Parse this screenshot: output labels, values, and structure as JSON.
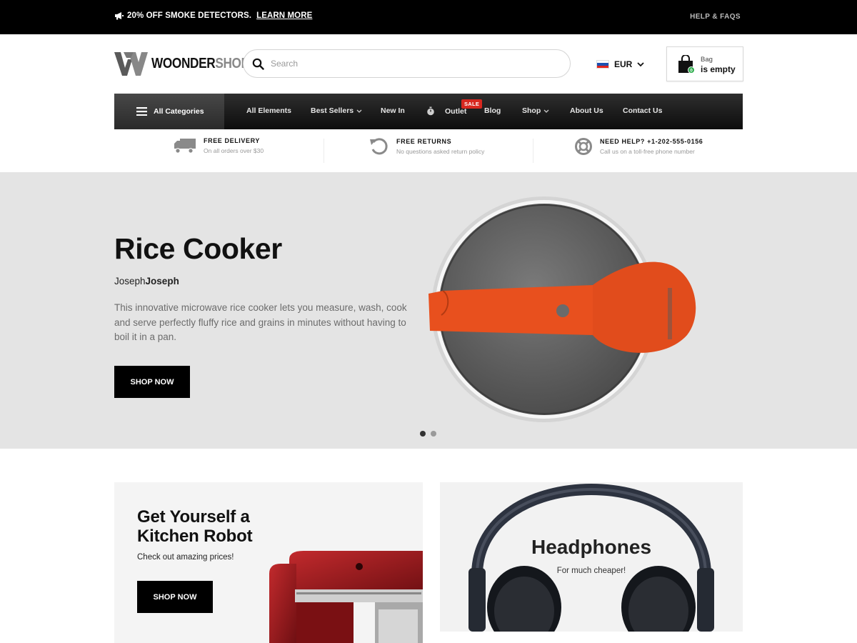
{
  "topbar": {
    "promo_text": "20% OFF SMOKE DETECTORS.",
    "promo_link": "LEARN MORE",
    "help_link": "HELP & FAQS"
  },
  "header": {
    "logo_part1": "WOONDER",
    "logo_part2": "SHOP",
    "search_placeholder": "Search",
    "currency": "EUR",
    "bag_label": "Bag",
    "bag_status": "is empty"
  },
  "nav": {
    "all_categories": "All Categories",
    "items": [
      {
        "label": "All Elements"
      },
      {
        "label": "Best Sellers"
      },
      {
        "label": "New In"
      },
      {
        "label": "Outlet"
      },
      {
        "label": "Blog"
      },
      {
        "label": "Shop"
      },
      {
        "label": "About Us"
      },
      {
        "label": "Contact Us"
      }
    ],
    "sale_badge": "SALE"
  },
  "features": [
    {
      "title": "FREE DELIVERY",
      "subtitle": "On all orders over $30",
      "icon": "truck-icon"
    },
    {
      "title": "FREE RETURNS",
      "subtitle": "No questions asked return policy",
      "icon": "return-icon"
    },
    {
      "title": "NEED HELP? +1-202-555-0156",
      "subtitle": "Call us on a toll-free phone number",
      "icon": "lifebuoy-icon"
    }
  ],
  "hero": {
    "title": "Rice Cooker",
    "brand_light": "Joseph",
    "brand_bold": "Joseph",
    "description": "This innovative microwave rice cooker lets you measure, wash, cook and serve perfectly fluffy rice and grains in minutes without having to boil it in a pan.",
    "button": "SHOP NOW",
    "slide_count": 2,
    "active_slide": 1
  },
  "promos": {
    "left": {
      "title": "Get Yourself a Kitchen Robot",
      "subtitle": "Check out amazing prices!",
      "button": "SHOP NOW"
    },
    "right": {
      "title": "Headphones",
      "subtitle": "For much cheaper!"
    }
  },
  "colors": {
    "topbar_bg": "#000000",
    "nav_bg": "#1a1a1a",
    "hero_bg": "#e4e4e4",
    "sale_red": "#d8281f",
    "accent_orange": "#e8501e",
    "mixer_red": "#8e1418"
  }
}
